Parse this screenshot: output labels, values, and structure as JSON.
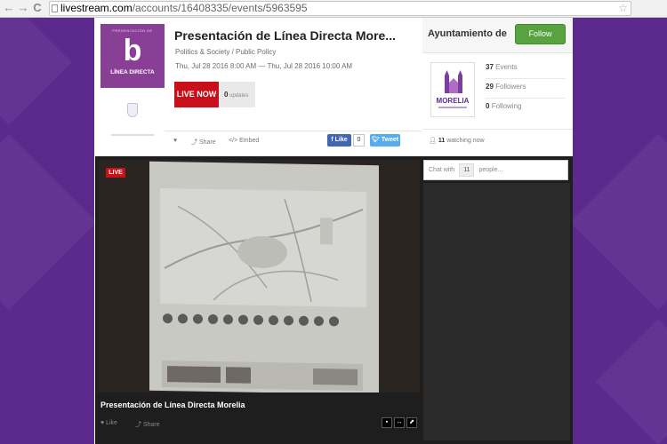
{
  "browser": {
    "back_label": "←",
    "forward_label": "→",
    "reload_label": "C",
    "url_host": "livestream.com",
    "url_path": "/accounts/16408335/events/5963595",
    "star_label": "☆"
  },
  "event": {
    "thumb_top": "PRESENTACIÓN DE",
    "thumb_logo": "b",
    "thumb_title": "LÍNEA DIRECTA",
    "title": "Presentación de Línea Directa More...",
    "category": "Politics & Society / Public Policy",
    "date": "Thu, Jul 28 2016 8:00 AM — Thu, Jul 28 2016 10:00 AM",
    "live_label": "LIVE NOW",
    "updates_count": "0",
    "updates_label": "updates"
  },
  "actions": {
    "heart_icon": "♥",
    "share_label": "Share",
    "embed_label": "Embed",
    "fb_like": "Like",
    "fb_count": "0",
    "tweet": "Tweet"
  },
  "channel": {
    "name": "Ayuntamiento de M",
    "follow_label": "Follow",
    "logo_word": "MORELIA",
    "events_count": "37",
    "events_label": "Events",
    "followers_count": "29",
    "followers_label": "Followers",
    "following_count": "0",
    "following_label": "Following",
    "watching_count": "11",
    "watching_label": "watching now"
  },
  "video": {
    "live_tag": "LIVE",
    "title": "Presentación de Línea Directa Morelia",
    "like_label": "Like",
    "share_label": "Share"
  },
  "chat": {
    "prefix": "Chat with",
    "count": "11",
    "suffix": "people..."
  },
  "colors": {
    "background": "#5b2a8c",
    "live_red": "#c9101a",
    "follow_green": "#58a23f",
    "facebook": "#4267b2",
    "twitter": "#55acee",
    "brand_purple": "#8a3f97"
  }
}
